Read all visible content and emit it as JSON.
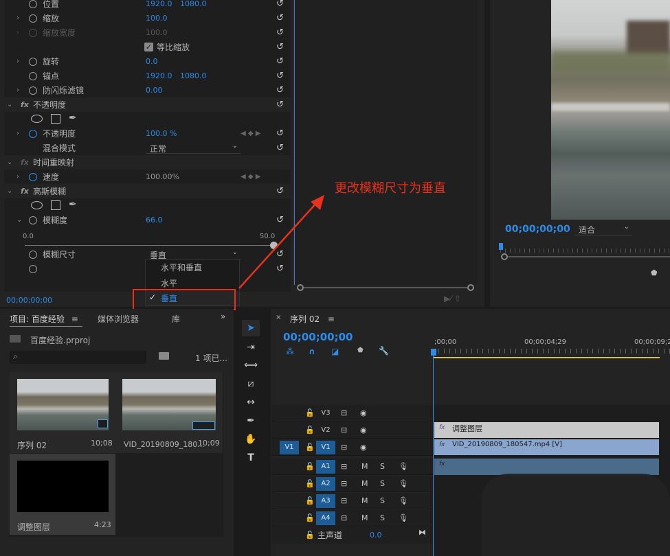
{
  "effects": {
    "position": {
      "label": "位置",
      "x": "1920.0",
      "y": "1080.0"
    },
    "scale": {
      "label": "缩放",
      "value": "100.0"
    },
    "scale_width": {
      "label": "缩放宽度",
      "value": "100.0"
    },
    "uniform_scale": {
      "label": "等比缩放",
      "checked": true
    },
    "rotation": {
      "label": "旋转",
      "value": "0.0"
    },
    "anchor": {
      "label": "锚点",
      "x": "1920.0",
      "y": "1080.0"
    },
    "antiflicker": {
      "label": "防闪烁滤镜",
      "value": "0.00"
    },
    "opacity_section": {
      "label": "不透明度",
      "fx": "fx"
    },
    "opacity": {
      "label": "不透明度",
      "value": "100.0 %"
    },
    "blend": {
      "label": "混合模式",
      "value": "正常"
    },
    "time_remap": {
      "label": "时间重映射",
      "fx": "fx"
    },
    "speed": {
      "label": "速度",
      "value": "100.00%"
    },
    "gaussian": {
      "label": "高斯模糊",
      "fx": "fx"
    },
    "blurriness": {
      "label": "模糊度",
      "value": "66.0",
      "min": "0.0",
      "max": "50.0"
    },
    "blur_dim": {
      "label": "模糊尺寸",
      "value": "垂直"
    },
    "dropdown": [
      "水平和垂直",
      "水平",
      "垂直"
    ],
    "timecode": "00;00;00;00"
  },
  "annotation": "更改模糊尺寸为垂直",
  "program": {
    "timecode": "00;00;00;00",
    "fit": "适合"
  },
  "project": {
    "tabs": [
      "项目: 百度经验",
      "媒体浏览器",
      "库"
    ],
    "file": "百度经验.prproj",
    "count": "1 项已...",
    "items": [
      {
        "name": "序列 02",
        "dur": "10;08"
      },
      {
        "name": "VID_20190809_180...",
        "dur": "10;09"
      },
      {
        "name": "调整图层",
        "dur": "4:23"
      }
    ]
  },
  "timeline": {
    "tab": "序列 02",
    "timecode": "00;00;00;00",
    "ruler": [
      ";00;00",
      "00;00;04;29",
      "00;00;09;2"
    ],
    "tracks": {
      "v3": "V3",
      "v2": "V2",
      "v1_src": "V1",
      "v1": "V1",
      "a1": "A1",
      "a2": "A2",
      "a3": "A3",
      "a4": "A4",
      "m": "M",
      "s": "S"
    },
    "master": {
      "label": "主声道",
      "value": "0.0"
    },
    "clips": {
      "adj": "调整图层",
      "vid": "VID_20190809_180547.mp4 [V]",
      "fx": "fx"
    }
  },
  "colors": {
    "accent": "#2d8ceb",
    "annotation": "#e8321e",
    "selection": "#1e5c96"
  }
}
